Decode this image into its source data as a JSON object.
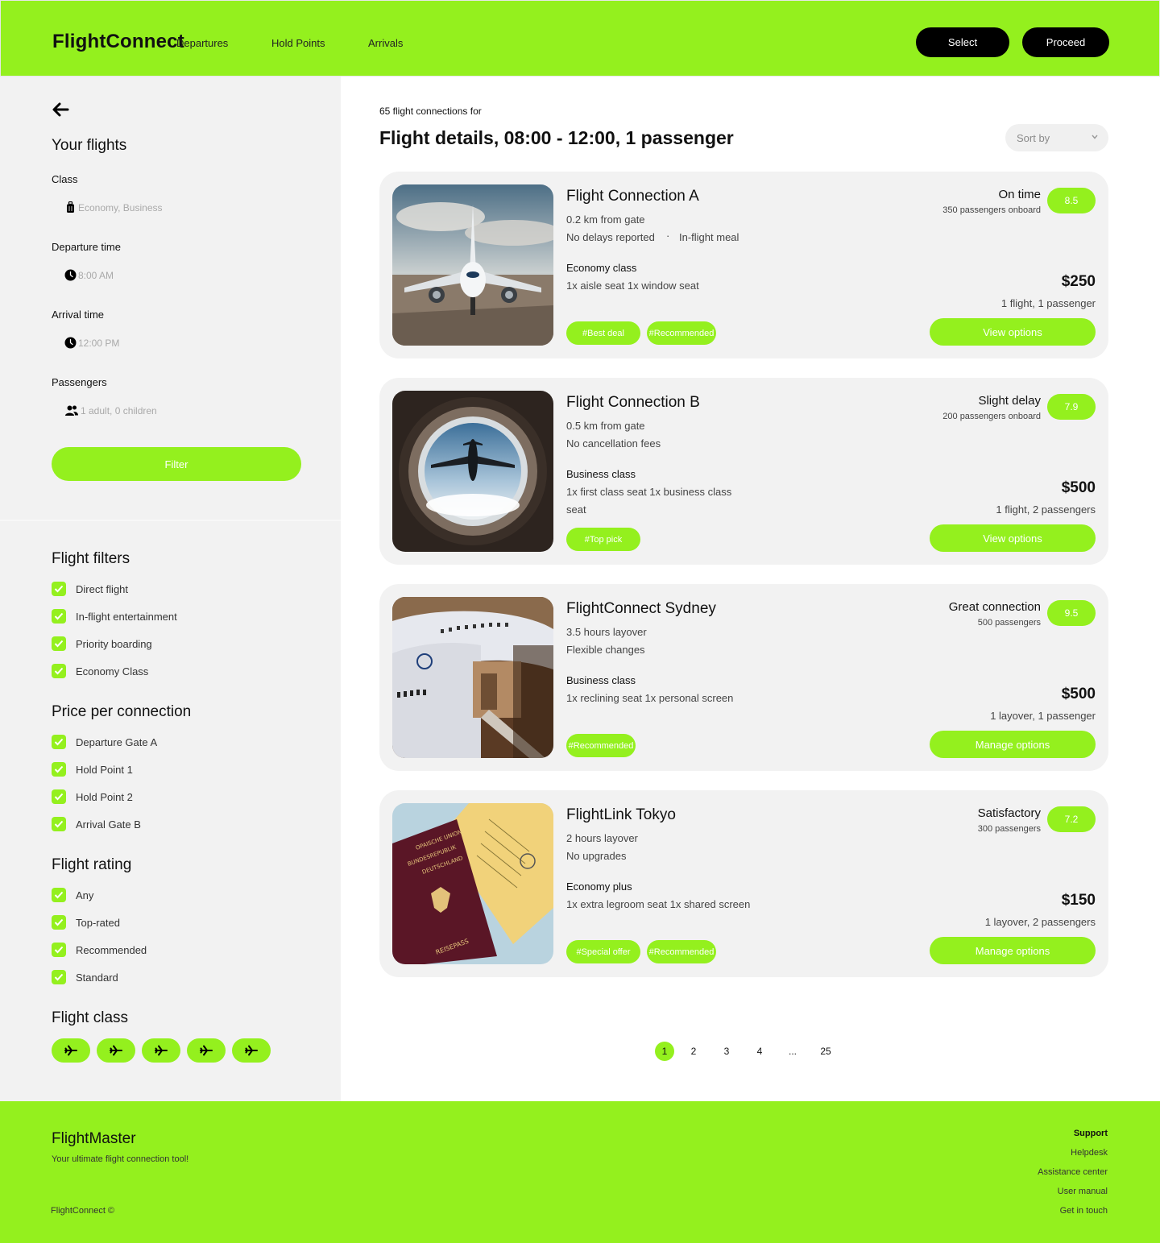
{
  "header": {
    "logo": "FlightConnect",
    "nav": [
      "Departures",
      "Hold Points",
      "Arrivals"
    ],
    "select_label": "Select",
    "proceed_label": "Proceed"
  },
  "sidebar": {
    "title": "Your flights",
    "fields": [
      {
        "label": "Class",
        "value": "Economy, Business",
        "icon": "luggage-icon"
      },
      {
        "label": "Departure time",
        "value": "8:00 AM",
        "icon": "clock-icon"
      },
      {
        "label": "Arrival time",
        "value": "12:00 PM",
        "icon": "clock-icon"
      },
      {
        "label": "Passengers",
        "value": "1 adult, 0 children",
        "icon": "people-icon"
      }
    ],
    "filter_label": "Filter",
    "flight_filters": {
      "title": "Flight filters",
      "items": [
        "Direct flight",
        "In-flight entertainment",
        "Priority boarding",
        "Economy Class"
      ]
    },
    "price_per_connection": {
      "title": "Price per connection",
      "items": [
        "Departure Gate A",
        "Hold Point 1",
        "Hold Point 2",
        "Arrival Gate B"
      ]
    },
    "flight_rating": {
      "title": "Flight rating",
      "items": [
        "Any",
        "Top-rated",
        "Recommended",
        "Standard"
      ]
    },
    "flight_class": {
      "title": "Flight class",
      "pill_count": 5,
      "icon": "plane-icon"
    }
  },
  "main": {
    "results_count": "65 flight connections for",
    "title": "Flight details, 08:00 - 12:00, 1 passenger",
    "sort_label": "Sort by",
    "cards": [
      {
        "title": "Flight Connection A",
        "line1": "0.2 km from gate",
        "line2": "No delays reported",
        "line2_extra": "In-flight meal",
        "class_title": "Economy class",
        "class_desc": "1x aisle seat 1x window seat",
        "class_desc2": "",
        "tags": [
          "#Best deal",
          "#Recommended"
        ],
        "status": "On time",
        "pax": "350 passengers onboard",
        "rating": "8.5",
        "price": "$250",
        "price_note": "1 flight, 1 passenger",
        "button": "View options"
      },
      {
        "title": "Flight Connection B",
        "line1": "0.5 km from gate",
        "line2": "No cancellation fees",
        "line2_extra": "",
        "class_title": "Business class",
        "class_desc": "1x first class seat 1x business class",
        "class_desc2": "seat",
        "tags": [
          "#Top pick"
        ],
        "status": "Slight delay",
        "pax": "200 passengers onboard",
        "rating": "7.9",
        "price": "$500",
        "price_note": "1 flight, 2 passengers",
        "button": "View options"
      },
      {
        "title": "FlightConnect Sydney",
        "line1": "3.5 hours layover",
        "line2": "Flexible changes",
        "line2_extra": "",
        "class_title": "Business class",
        "class_desc": "1x reclining seat 1x personal screen",
        "class_desc2": "",
        "tags": [
          "#Recommended"
        ],
        "status": "Great connection",
        "pax": "500 passengers",
        "rating": "9.5",
        "price": "$500",
        "price_note": "1 layover, 1 passenger",
        "button": "Manage options"
      },
      {
        "title": "FlightLink Tokyo",
        "line1": "2 hours layover",
        "line2": "No upgrades",
        "line2_extra": "",
        "class_title": "Economy plus",
        "class_desc": "1x extra legroom seat 1x shared screen",
        "class_desc2": "",
        "tags": [
          "#Special offer",
          "#Recommended"
        ],
        "status": "Satisfactory",
        "pax": "300 passengers",
        "rating": "7.2",
        "price": "$150",
        "price_note": "1 layover, 2 passengers",
        "button": "Manage options"
      }
    ],
    "pagination": [
      "1",
      "2",
      "3",
      "4",
      "...",
      "25"
    ],
    "current_page": "1"
  },
  "footer": {
    "brand": "FlightMaster",
    "tagline": "Your ultimate flight connection tool!",
    "copyright": "FlightConnect ©",
    "support_title": "Support",
    "links": [
      "Helpdesk",
      "Assistance center",
      "User manual",
      "Get in touch"
    ]
  },
  "colors": {
    "accent": "#94f01e",
    "sidebar": "#f2f2f2",
    "card": "#f2f2f2",
    "button_dark": "#000000"
  }
}
